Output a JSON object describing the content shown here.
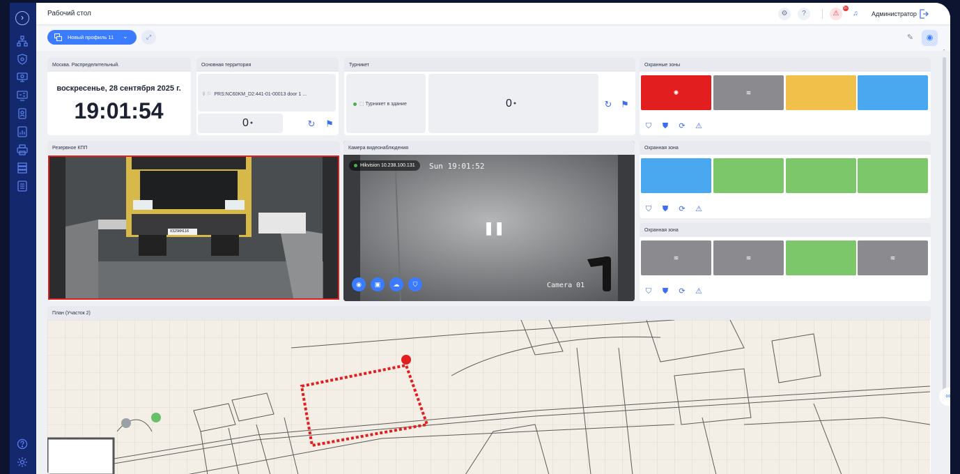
{
  "app": {
    "title": "Рабочий стол",
    "user": "Администратор",
    "alarm_count": "9+"
  },
  "sidebar": {
    "items": [
      {
        "icon": "org-structure-icon"
      },
      {
        "icon": "shield-icon"
      },
      {
        "icon": "monitor-icon"
      },
      {
        "icon": "video-wall-icon"
      },
      {
        "icon": "badge-icon"
      },
      {
        "icon": "reports-icon"
      },
      {
        "icon": "printer-icon"
      },
      {
        "icon": "server-icon"
      },
      {
        "icon": "log-icon"
      }
    ],
    "bottom": [
      {
        "icon": "help-icon"
      },
      {
        "icon": "settings-icon"
      }
    ]
  },
  "toolbar": {
    "profile_label": "Новый профиль 11"
  },
  "widgets": {
    "clock": {
      "title": "Москва. Распределительный.",
      "date": "воскресенье, 28 сентября 2025 г.",
      "time": "19:01:54"
    },
    "territory": {
      "title": "Основная территория",
      "door": "PRS:NC60KM_D2:441-01-00013 door 1 ...",
      "count": "0"
    },
    "turnstile": {
      "title": "Турникет",
      "entry": "Турникет в здание",
      "count": "0"
    },
    "zones_top": {
      "title": "Охранные зоны",
      "cells": [
        {
          "state": "alarm",
          "color": "#e31e1e"
        },
        {
          "state": "offline",
          "color": "#8b8b8f"
        },
        {
          "state": "warning",
          "color": "#f0c04a"
        },
        {
          "state": "disarmed",
          "color": "#4aa8f0"
        }
      ]
    },
    "reserve_kpp": {
      "title": "Резервное КПП",
      "plate": "Х325КН116"
    },
    "video_camera": {
      "title": "Камера видеонаблюдения",
      "label": "Hikvision 10.238.100.131",
      "overlay_time": "Sun 19:01:52",
      "overlay_name": "Camera 01"
    },
    "zone_middle": {
      "title": "Охранная зона",
      "cells": [
        {
          "state": "disarmed",
          "color": "#4aa8f0"
        },
        {
          "state": "armed",
          "color": "#7cc76a"
        },
        {
          "state": "armed",
          "color": "#7cc76a"
        },
        {
          "state": "armed",
          "color": "#7cc76a"
        }
      ]
    },
    "zone_bottom": {
      "title": "Охранная зона",
      "cells": [
        {
          "state": "offline",
          "color": "#8b8b8f"
        },
        {
          "state": "offline",
          "color": "#8b8b8f"
        },
        {
          "state": "armed",
          "color": "#7cc76a"
        },
        {
          "state": "offline",
          "color": "#8b8b8f"
        }
      ]
    },
    "plan": {
      "title": "План (Участок 2)"
    }
  }
}
